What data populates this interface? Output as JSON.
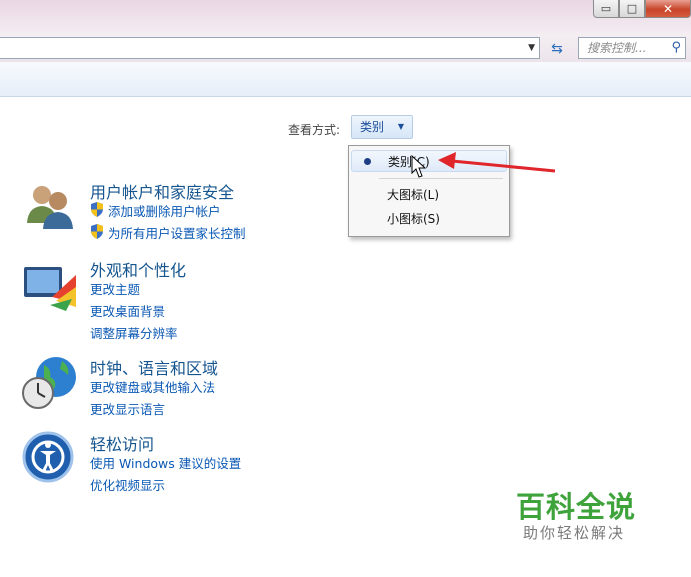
{
  "window": {
    "min_glyph": "▭",
    "max_glyph": "□",
    "close_glyph": "✕"
  },
  "address": {
    "dropdown_glyph": "▼",
    "refresh_glyph": "⇆"
  },
  "search": {
    "placeholder": "搜索控制...",
    "icon_glyph": "⚲"
  },
  "view": {
    "label": "查看方式:",
    "current": "类别",
    "arrow_glyph": "▼",
    "menu": [
      "类别(C)",
      "大图标(L)",
      "小图标(S)"
    ]
  },
  "categories": [
    {
      "title": "用户帐户和家庭安全",
      "links": [
        "添加或删除用户帐户",
        "为所有用户设置家长控制"
      ]
    },
    {
      "title": "外观和个性化",
      "links": [
        "更改主题",
        "更改桌面背景",
        "调整屏幕分辨率"
      ]
    },
    {
      "title": "时钟、语言和区域",
      "links": [
        "更改键盘或其他输入法",
        "更改显示语言"
      ]
    },
    {
      "title": "轻松访问",
      "links": [
        "使用 Windows 建议的设置",
        "优化视频显示"
      ]
    }
  ],
  "watermark": {
    "title": "百科全说",
    "subtitle": "助你轻松解决"
  },
  "colors": {
    "link": "#0b59b4",
    "category_title": "#15558f",
    "arrow": "#e0262b",
    "watermark": "#3ea33a"
  }
}
